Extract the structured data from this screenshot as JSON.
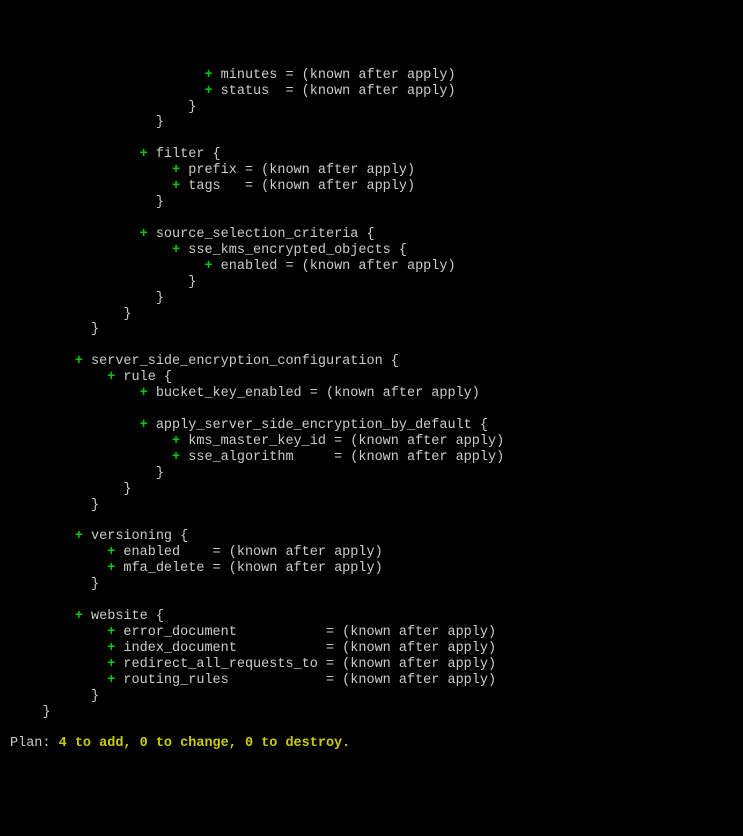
{
  "lines": {
    "l00a": "+",
    "l00b": " minutes = (known after apply)",
    "l01a": "+",
    "l01b": " status  = (known after apply)",
    "l02": "}",
    "l03": "}",
    "l05a": "+",
    "l05b": " filter {",
    "l06a": "+",
    "l06b": " prefix = (known after apply)",
    "l07a": "+",
    "l07b": " tags   = (known after apply)",
    "l08": "}",
    "l10a": "+",
    "l10b": " source_selection_criteria {",
    "l11a": "+",
    "l11b": " sse_kms_encrypted_objects {",
    "l12a": "+",
    "l12b": " enabled = (known after apply)",
    "l13": "}",
    "l14": "}",
    "l15": "}",
    "l16": "}",
    "l18a": "+",
    "l18b": " server_side_encryption_configuration {",
    "l19a": "+",
    "l19b": " rule {",
    "l20a": "+",
    "l20b": " bucket_key_enabled = (known after apply)",
    "l22a": "+",
    "l22b": " apply_server_side_encryption_by_default {",
    "l23a": "+",
    "l23b": " kms_master_key_id = (known after apply)",
    "l24a": "+",
    "l24b": " sse_algorithm     = (known after apply)",
    "l25": "}",
    "l26": "}",
    "l27": "}",
    "l29a": "+",
    "l29b": " versioning {",
    "l30a": "+",
    "l30b": " enabled    = (known after apply)",
    "l31a": "+",
    "l31b": " mfa_delete = (known after apply)",
    "l32": "}",
    "l34a": "+",
    "l34b": " website {",
    "l35a": "+",
    "l35b": " error_document           = (known after apply)",
    "l36a": "+",
    "l36b": " index_document           = (known after apply)",
    "l37a": "+",
    "l37b": " redirect_all_requests_to = (known after apply)",
    "l38a": "+",
    "l38b": " routing_rules            = (known after apply)",
    "l39": "}",
    "l40": "}",
    "planlabel": "Plan:",
    "plan0": " 4 to add, 0 to change, 0 to destroy."
  }
}
